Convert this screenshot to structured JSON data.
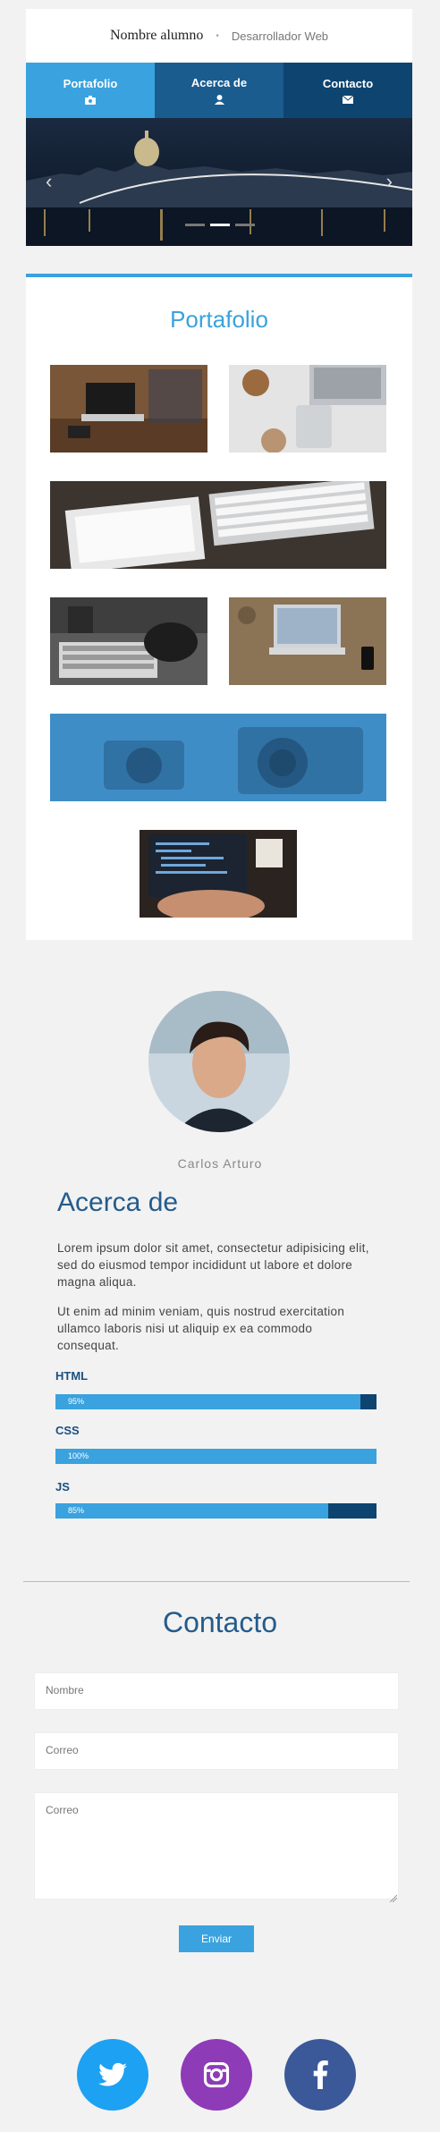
{
  "header": {
    "name": "Nombre alumno",
    "separator": "•",
    "role": "Desarrollador Web"
  },
  "nav": {
    "tabs": [
      {
        "label": "Portafolio",
        "icon": "camera-icon"
      },
      {
        "label": "Acerca de",
        "icon": "user-icon"
      },
      {
        "label": "Contacto",
        "icon": "envelope-icon"
      }
    ]
  },
  "slider": {
    "prev": "‹",
    "next": "›",
    "slides": 3,
    "active": 2
  },
  "portfolio": {
    "title": "Portafolio"
  },
  "about": {
    "name": "Carlos Arturo",
    "title": "Acerca de",
    "paragraphs": [
      "Lorem ipsum dolor sit amet, consectetur adipisicing elit, sed do eiusmod tempor incididunt ut labore et dolore magna aliqua.",
      "Ut enim ad minim veniam, quis nostrud exercitation ullamco laboris nisi ut aliquip ex ea commodo consequat."
    ],
    "skills": [
      {
        "name": "HTML",
        "value": "95%",
        "percent": 95
      },
      {
        "name": "CSS",
        "value": "100%",
        "percent": 100
      },
      {
        "name": "JS",
        "value": "85%",
        "percent": 85
      }
    ]
  },
  "contact": {
    "title": "Contacto",
    "name_placeholder": "Nombre",
    "email_placeholder": "Correo",
    "message_placeholder": "Correo",
    "send_label": "Enviar"
  },
  "social": [
    {
      "name": "twitter",
      "color": "#1da1f2"
    },
    {
      "name": "instagram",
      "color": "#8e3bb8"
    },
    {
      "name": "facebook",
      "color": "#3b5998"
    }
  ],
  "colors": {
    "accent": "#3aa2de",
    "dark_blue": "#0e4470",
    "heading": "#245c8c"
  }
}
